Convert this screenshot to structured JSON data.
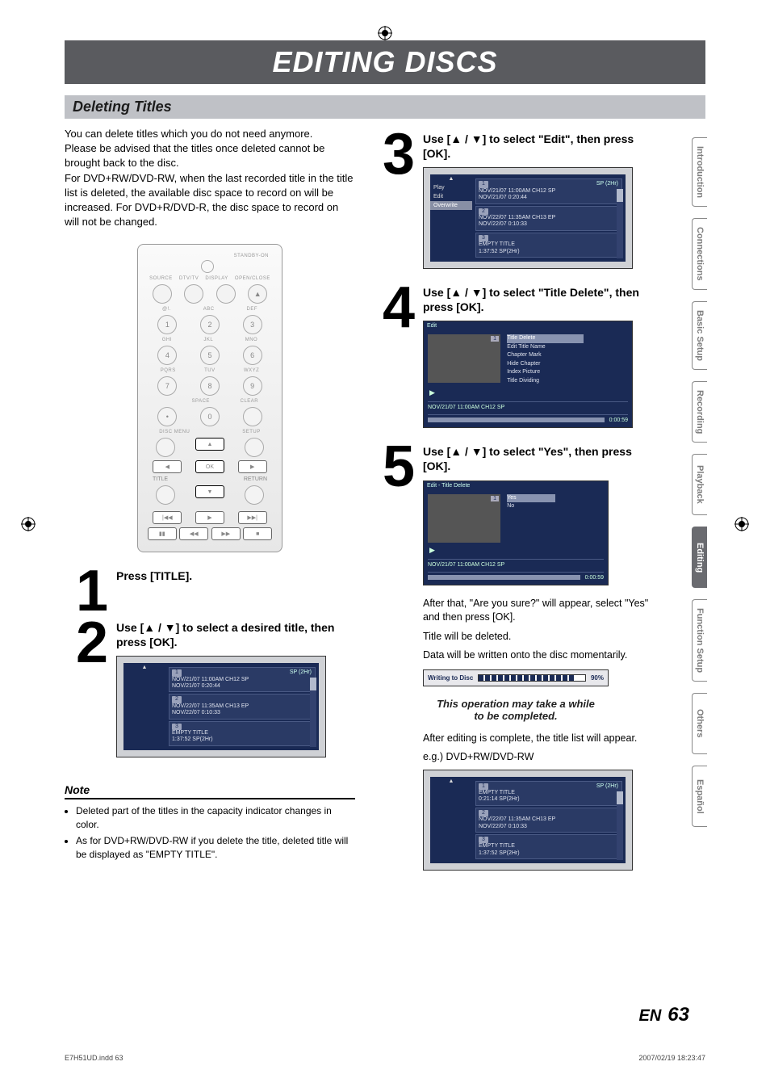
{
  "header": {
    "title": "EDITING DISCS",
    "section": "Deleting Titles"
  },
  "intro": {
    "p1": "You can delete titles which you do not need anymore.",
    "p2": "Please be advised that the titles once deleted cannot be brought back to the disc.",
    "p3": "For DVD+RW/DVD-RW, when the last recorded title in the title list is deleted, the available disc space to record on will be increased. For DVD+R/DVD-R, the disc space to record on will not be changed."
  },
  "remote": {
    "standby": "STANDBY-ON",
    "row1": [
      "SOURCE",
      "DTV/TV",
      "DISPLAY",
      "OPEN/CLOSE"
    ],
    "row_lbl1": [
      "@!.",
      "ABC",
      "DEF"
    ],
    "row_lbl2": [
      "GHI",
      "JKL",
      "MNO"
    ],
    "row_lbl3": [
      "PQRS",
      "TUV",
      "WXYZ"
    ],
    "row_lbl4": [
      "",
      "SPACE",
      "CLEAR"
    ],
    "discmenu": "DISC MENU",
    "setup": "SETUP",
    "ok": "OK",
    "title_btn": "TITLE",
    "return_btn": "RETURN"
  },
  "steps": {
    "s1": {
      "num": "1",
      "head": "Press [TITLE]."
    },
    "s2": {
      "num": "2",
      "head": "Use [▲ / ▼] to select a desired title, then press [OK]."
    },
    "s3": {
      "num": "3",
      "head": "Use [▲ / ▼] to select \"Edit\", then press [OK]."
    },
    "s4": {
      "num": "4",
      "head": "Use [▲ / ▼] to select \"Title Delete\", then press [OK]."
    },
    "s5": {
      "num": "5",
      "head": "Use [▲ / ▼] to select \"Yes\", then press [OK]."
    }
  },
  "osd": {
    "mode1": "SP (2Hr)",
    "t1": {
      "line1": "NOV/21/07 11:00AM CH12 SP",
      "line2": "NOV/21/07   0:20:44"
    },
    "t2": {
      "line1": "NOV/22/07 11:35AM CH13 EP",
      "line2": "NOV/22/07   0:10:33"
    },
    "t3": {
      "line1": "EMPTY TITLE",
      "line2": "1:37:52  SP(2Hr)"
    },
    "menu": {
      "play": "Play",
      "edit": "Edit",
      "overwrite": "Overwrite"
    },
    "edit_header": "Edit",
    "edit_opts": [
      "Title Delete",
      "Edit Title Name",
      "Chapter Mark",
      "Hide Chapter",
      "Index Picture",
      "Title Dividing"
    ],
    "info_line": "NOV/21/07 11:00AM CH12 SP",
    "timecode": "0:00:59",
    "delete_header": "Edit - Title Delete",
    "yes": "Yes",
    "no": "No",
    "writing": "Writing to Disc",
    "writing_pct": "90%",
    "result_t1": {
      "line1": "EMPTY TITLE",
      "line2": "0:21:14  SP(2Hr)"
    }
  },
  "aftertext": {
    "a1": "After that, \"Are you sure?\" will appear, select \"Yes\" and then press [OK].",
    "a2": "Title will be deleted.",
    "a3": "Data will be written onto the disc momentarily.",
    "callout": "This operation may take a while to be completed.",
    "a4": "After editing is complete, the title list will appear.",
    "a5": "e.g.) DVD+RW/DVD-RW"
  },
  "note": {
    "head": "Note",
    "n1": "Deleted part of the titles in the capacity indicator changes in color.",
    "n2": "As for DVD+RW/DVD-RW if you delete the title, deleted title will be displayed as \"EMPTY TITLE\"."
  },
  "tabs": [
    "Introduction",
    "Connections",
    "Basic Setup",
    "Recording",
    "Playback",
    "Editing",
    "Function Setup",
    "Others",
    "Español"
  ],
  "footer": {
    "en": "EN",
    "page": "63",
    "file": "E7H51UD.indd   63",
    "stamp": "2007/02/19   18:23:47"
  }
}
